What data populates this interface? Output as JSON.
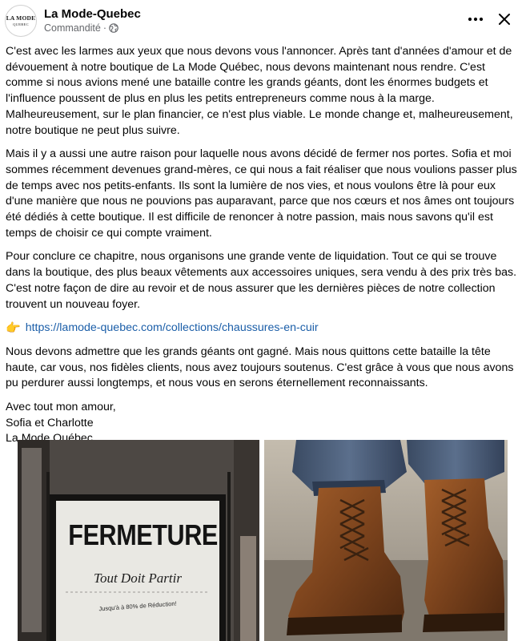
{
  "header": {
    "page_name": "La Mode-Quebec",
    "sponsored": "Commandité",
    "separator": "·",
    "avatar_line1": "LA MODE",
    "avatar_line2": "QUEBEC",
    "more_icon": "more-horizontal-icon",
    "close_icon": "close-icon"
  },
  "post": {
    "paragraphs": [
      "C'est avec les larmes aux yeux que nous devons vous l'annoncer. Après tant d'années d'amour et de dévouement à notre boutique de La Mode Québec, nous devons maintenant nous rendre. C'est comme si nous avions mené une bataille contre les grands géants, dont les énormes budgets et l'influence poussent de plus en plus les petits entrepreneurs comme nous à la marge. Malheureusement, sur le plan financier, ce n'est plus viable. Le monde change et, malheureusement, notre boutique ne peut plus suivre.",
      "Mais il y a aussi une autre raison pour laquelle nous avons décidé de fermer nos portes. Sofia et moi sommes récemment devenues grand-mères, ce qui nous a fait réaliser que nous voulions passer plus de temps avec nos petits-enfants. Ils sont la lumière de nos vies, et nous voulons être là pour eux d'une manière que nous ne pouvions pas auparavant, parce que nos cœurs et nos âmes ont toujours été dédiés à cette boutique. Il est difficile de renoncer à notre passion, mais nous savons qu'il est temps de choisir ce qui compte vraiment.",
      "Pour conclure ce chapitre, nous organisons une grande vente de liquidation. Tout ce qui se trouve dans la boutique, des plus beaux vêtements aux accessoires uniques, sera vendu à des prix très bas. C'est notre façon de dire au revoir et de nous assurer que les dernières pièces de notre collection trouvent un nouveau foyer."
    ],
    "link_emoji": "👉",
    "link_text": "https://lamode-quebec.com/collections/chaussures-en-cuir",
    "paragraph_after_link": "Nous devons admettre que les grands géants ont gagné. Mais nous quittons cette bataille la tête haute, car vous, nos fidèles clients, nous avez toujours soutenus. C'est grâce à vous que nous avons pu perdurer aussi longtemps, et nous vous en serons éternellement reconnaissants.",
    "signoff": [
      "Avec tout mon amour,",
      "Sofia et Charlotte",
      "La Mode Québec"
    ]
  },
  "images": {
    "left": {
      "sign_title": "FERMETURE",
      "sign_subtitle": "Tout Doit Partir",
      "sign_small": "Jusqu'à à 80% de Réduction!"
    },
    "right": {
      "subject": "leather-boots-photo"
    }
  }
}
